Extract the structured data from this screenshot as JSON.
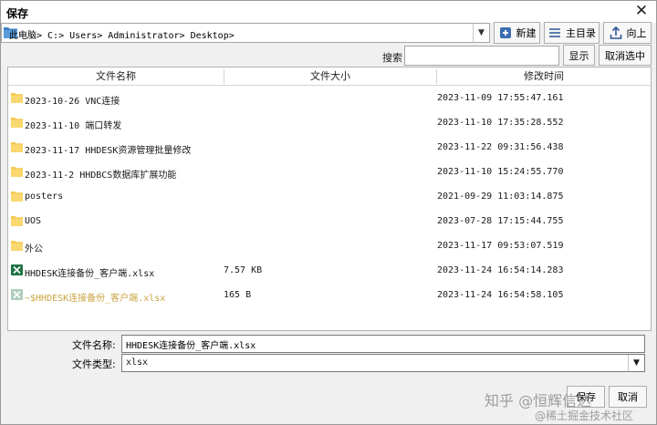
{
  "window": {
    "title": "保存",
    "close_glyph": "✕"
  },
  "path": {
    "value": "此电脑> C:> Users> Administrator> Desktop>"
  },
  "toolbar": {
    "new_label": "新建",
    "home_label": "主目录",
    "up_label": "向上"
  },
  "search": {
    "label": "搜索",
    "value": "",
    "show_label": "显示",
    "cancel_label": "取消选中"
  },
  "columns": {
    "name": "文件名称",
    "size": "文件大小",
    "modified": "修改时间"
  },
  "files": [
    {
      "name": "2023-10-26 VNC连接",
      "size": "",
      "modified": "2023-11-09 17:55:47.161",
      "type": "folder"
    },
    {
      "name": "2023-11-10 端口转发",
      "size": "",
      "modified": "2023-11-10 17:35:28.552",
      "type": "folder"
    },
    {
      "name": "2023-11-17 HHDESK资源管理批量修改",
      "size": "",
      "modified": "2023-11-22 09:31:56.438",
      "type": "folder"
    },
    {
      "name": "2023-11-2 HHDBCS数据库扩展功能",
      "size": "",
      "modified": "2023-11-10 15:24:55.770",
      "type": "folder"
    },
    {
      "name": "posters",
      "size": "",
      "modified": "2021-09-29 11:03:14.875",
      "type": "folder"
    },
    {
      "name": "UOS",
      "size": "",
      "modified": "2023-07-28 17:15:44.755",
      "type": "folder"
    },
    {
      "name": "外公",
      "size": "",
      "modified": "2023-11-17 09:53:07.519",
      "type": "folder"
    },
    {
      "name": "HHDESK连接备份_客户端.xlsx",
      "size": "7.57 KB",
      "modified": "2023-11-24 16:54:14.283",
      "type": "excel"
    },
    {
      "name": "~$HHDESK连接备份_客户端.xlsx",
      "size": "165 B",
      "modified": "2023-11-24 16:54:58.105",
      "type": "excel-temp"
    }
  ],
  "form": {
    "filename_label": "文件名称:",
    "filename_value": "HHDESK连接备份_客户端.xlsx",
    "filetype_label": "文件类型:",
    "filetype_value": "xlsx"
  },
  "buttons": {
    "save_label": "保存",
    "cancel_label": "取消"
  },
  "watermark": {
    "main": "知乎 @恒辉信达",
    "sub": "@稀土掘金技术社区"
  },
  "colors": {
    "folder": "#f3c94e",
    "excel": "#1f7244",
    "faded_text": "#c9a443"
  }
}
